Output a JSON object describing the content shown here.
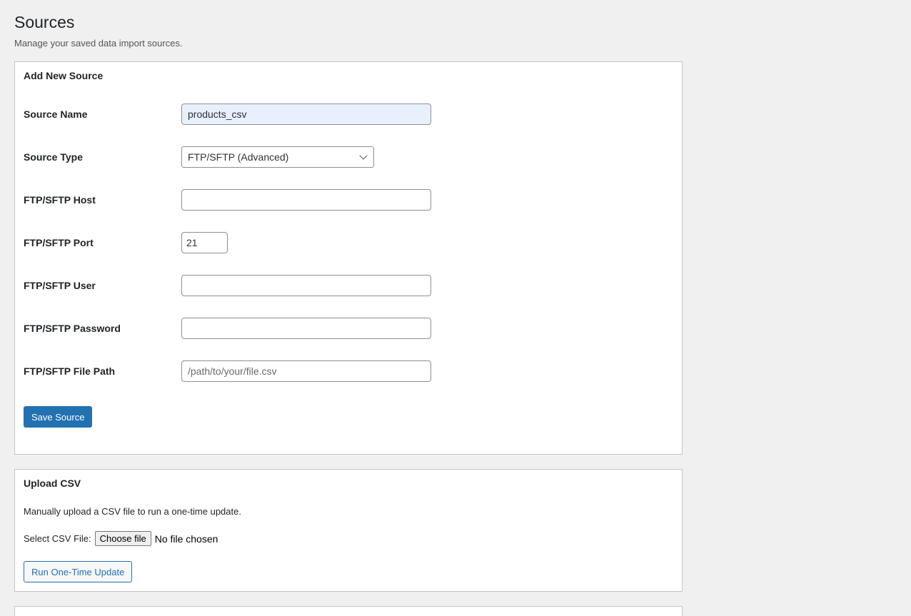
{
  "page": {
    "title": "Sources",
    "description": "Manage your saved data import sources."
  },
  "add_source": {
    "title": "Add New Source",
    "fields": {
      "source_name": {
        "label": "Source Name",
        "value": "products_csv"
      },
      "source_type": {
        "label": "Source Type",
        "selected": "FTP/SFTP (Advanced)"
      },
      "host": {
        "label": "FTP/SFTP Host",
        "value": ""
      },
      "port": {
        "label": "FTP/SFTP Port",
        "value": "21"
      },
      "user": {
        "label": "FTP/SFTP User",
        "value": ""
      },
      "password": {
        "label": "FTP/SFTP Password",
        "value": ""
      },
      "file_path": {
        "label": "FTP/SFTP File Path",
        "value": "",
        "placeholder": "/path/to/your/file.csv"
      }
    },
    "save_label": "Save Source"
  },
  "upload_csv": {
    "title": "Upload CSV",
    "description": "Manually upload a CSV file to run a one-time update.",
    "select_label": "Select CSV File:",
    "choose_button": "Choose file",
    "file_status": "No file chosen",
    "run_button": "Run One-Time Update"
  },
  "colors": {
    "background": "#f0f0f1",
    "accent": "#2271b1",
    "autofill": "#e8f0fe"
  }
}
